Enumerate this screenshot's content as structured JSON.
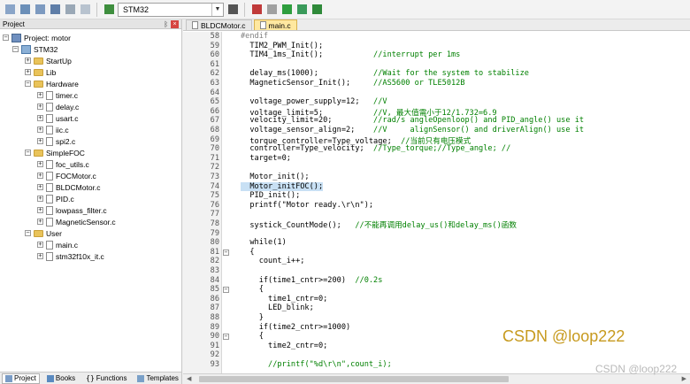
{
  "toolbar": {
    "target_name": "STM32"
  },
  "project_panel": {
    "title": "Project",
    "tabs": [
      {
        "label": "Project"
      },
      {
        "label": "Books"
      },
      {
        "label": "Functions"
      },
      {
        "label": "Templates"
      }
    ]
  },
  "tree": {
    "root": "Project: motor",
    "target": "STM32",
    "startup": "StartUp",
    "lib": "Lib",
    "hardware": "Hardware",
    "hw_files": [
      "timer.c",
      "delay.c",
      "usart.c",
      "iic.c",
      "spi2.c"
    ],
    "simplefoc": "SimpleFOC",
    "foc_files": [
      "foc_utils.c",
      "FOCMotor.c",
      "BLDCMotor.c",
      "PID.c",
      "lowpass_filter.c",
      "MagneticSensor.c"
    ],
    "user": "User",
    "user_files": [
      "main.c",
      "stm32f10x_it.c"
    ]
  },
  "editor": {
    "tabs": [
      {
        "label": "BLDCMotor.c"
      },
      {
        "label": "main.c"
      }
    ],
    "lines": [
      {
        "n": "58",
        "t": "#endif"
      },
      {
        "n": "59",
        "t": "  TIM2_PWM_Init();"
      },
      {
        "n": "60",
        "t": "  TIM4_1ms_Init();           //interrupt per 1ms"
      },
      {
        "n": "61",
        "t": ""
      },
      {
        "n": "62",
        "t": "  delay_ms(1000);            //Wait for the system to stabilize"
      },
      {
        "n": "63",
        "t": "  MagneticSensor_Init();     //AS5600 or TLE5012B"
      },
      {
        "n": "64",
        "t": ""
      },
      {
        "n": "65",
        "t": "  voltage_power_supply=12;   //V"
      },
      {
        "n": "66",
        "t": "  voltage_limit=5;           //V, 最大值需小于12/1.732=6.9"
      },
      {
        "n": "67",
        "t": "  velocity_limit=20;         //rad/s angleOpenloop() and PID_angle() use it"
      },
      {
        "n": "68",
        "t": "  voltage_sensor_align=2;    //V     alignSensor() and driverAlign() use it"
      },
      {
        "n": "69",
        "t": "  torque_controller=Type_voltage;  //当前只有电压模式"
      },
      {
        "n": "70",
        "t": "  controller=Type_velocity;  //Type_torque;//Type_angle; //"
      },
      {
        "n": "71",
        "t": "  target=0;"
      },
      {
        "n": "72",
        "t": ""
      },
      {
        "n": "73",
        "t": "  Motor_init();"
      },
      {
        "n": "74",
        "t": "  Motor_initFOC();"
      },
      {
        "n": "75",
        "t": "  PID_init();"
      },
      {
        "n": "76",
        "t": "  printf(\"Motor ready.\\r\\n\");"
      },
      {
        "n": "77",
        "t": ""
      },
      {
        "n": "78",
        "t": "  systick_CountMode();   //不能再调用delay_us()和delay_ms()函数"
      },
      {
        "n": "79",
        "t": ""
      },
      {
        "n": "80",
        "t": "  while(1)"
      },
      {
        "n": "81",
        "t": "  {"
      },
      {
        "n": "82",
        "t": "    count_i++;"
      },
      {
        "n": "83",
        "t": ""
      },
      {
        "n": "84",
        "t": "    if(time1_cntr>=200)  //0.2s"
      },
      {
        "n": "85",
        "t": "    {"
      },
      {
        "n": "86",
        "t": "      time1_cntr=0;"
      },
      {
        "n": "87",
        "t": "      LED_blink;"
      },
      {
        "n": "88",
        "t": "    }"
      },
      {
        "n": "89",
        "t": "    if(time2_cntr>=1000)"
      },
      {
        "n": "90",
        "t": "    {"
      },
      {
        "n": "91",
        "t": "      time2_cntr=0;"
      },
      {
        "n": "92",
        "t": ""
      },
      {
        "n": "93",
        "t": "      //printf(\"%d\\r\\n\",count_i);"
      }
    ]
  },
  "watermark": {
    "main": "CSDN @loop222",
    "corner": "CSDN @loop222"
  },
  "colors": {
    "comment": "#008000",
    "number": "#800080",
    "preprocessor": "#808080",
    "selection": "#c8e0f4",
    "active_tab": "#ffe8a0",
    "watermark": "#c79a1e"
  }
}
